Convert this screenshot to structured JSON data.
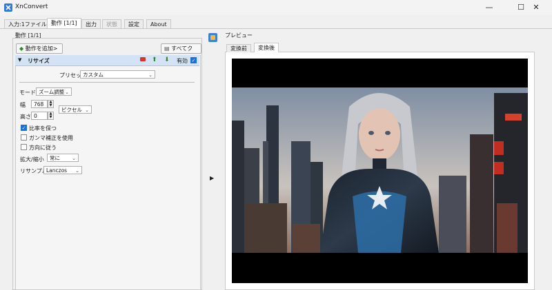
{
  "window": {
    "title": "XnConvert",
    "minimize": "—",
    "maximize": "☐",
    "close": "✕"
  },
  "tabs": [
    {
      "label": "入力:1ファイル"
    },
    {
      "label": "動作 [1/1]"
    },
    {
      "label": "出力"
    },
    {
      "label": "状態"
    },
    {
      "label": "設定"
    },
    {
      "label": "About"
    }
  ],
  "actions": {
    "group_label": "動作 [1/1]",
    "add_button": "動作を追加>",
    "clear_button": "すべてクリア"
  },
  "resize": {
    "title": "リサイズ",
    "enabled_label": "有効",
    "preset_label": "プリセット",
    "preset_value": "カスタム",
    "mode_label": "モード",
    "mode_value": "ズーム調整",
    "width_label": "幅",
    "width_value": "768",
    "height_label": "高さ",
    "height_value": "0",
    "unit_value": "ピクセル",
    "keep_ratio": "比率を保つ",
    "gamma": "ガンマ補正を使用",
    "orientation": "方向に従う",
    "enlarge_label": "拡大/縮小",
    "enlarge_value": "常に",
    "resample_label": "リサンプル",
    "resample_value": "Lanczos"
  },
  "preview": {
    "group_label": "プレビュー",
    "tab_before": "変換前",
    "tab_after": "変換後"
  }
}
